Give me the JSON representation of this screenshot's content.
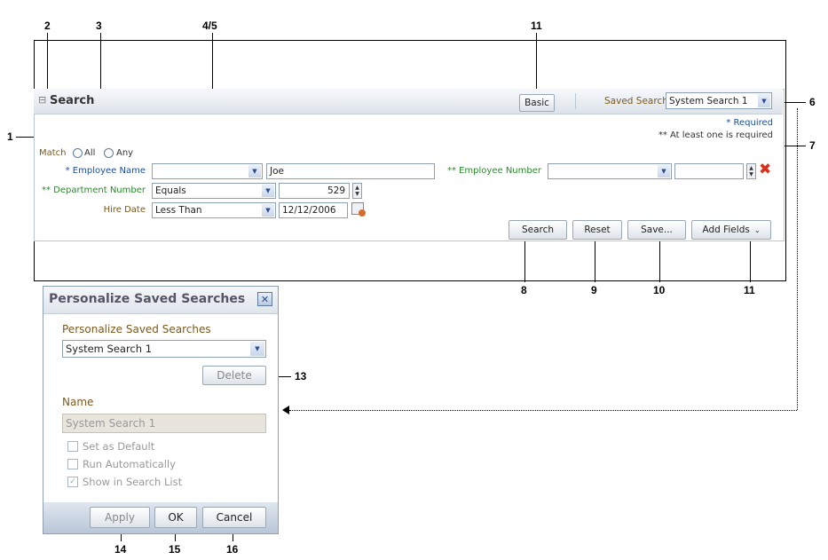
{
  "callouts": {
    "c2": "2",
    "c3": "3",
    "c45": "4/5",
    "c11_top": "11",
    "c1": "1",
    "c6": "6",
    "c7": "7",
    "c8": "8",
    "c9": "9",
    "c10": "10",
    "c11_bottom": "11",
    "c13": "13",
    "c14": "14",
    "c15": "15",
    "c16": "16"
  },
  "search_panel": {
    "title": "Search",
    "collapse_glyph": "⊟",
    "basic_label": "Basic",
    "saved_search_label": "Saved Search",
    "saved_search_value": "System Search 1",
    "required_note": "* Required",
    "at_least_one_note": "** At least one is required",
    "match_label": "Match",
    "match_all": "All",
    "match_any": "Any",
    "employee_name_label": "* Employee Name",
    "employee_name_operator": "",
    "employee_name_value": "Joe",
    "employee_number_label": "** Employee Number",
    "employee_number_operator": "",
    "employee_number_value": "",
    "department_number_label": "** Department Number",
    "department_number_operator": "Equals",
    "department_number_value": "529",
    "hire_date_label": "Hire Date",
    "hire_date_operator": "Less Than",
    "hire_date_value": "12/12/2006",
    "search_btn": "Search",
    "reset_btn": "Reset",
    "save_btn": "Save...",
    "add_fields_btn": "Add Fields"
  },
  "dialog": {
    "title": "Personalize Saved Searches",
    "section_label": "Personalize Saved Searches",
    "selected_search": "System Search 1",
    "delete_btn": "Delete",
    "name_label": "Name",
    "name_value": "System Search 1",
    "set_default": "Set as Default",
    "run_auto": "Run Automatically",
    "show_in_list": "Show in Search List",
    "apply_btn": "Apply",
    "ok_btn": "OK",
    "cancel_btn": "Cancel"
  }
}
